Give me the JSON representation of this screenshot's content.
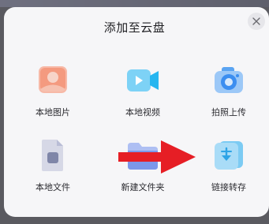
{
  "dialog": {
    "title": "添加至云盘",
    "close_icon": "close-icon"
  },
  "tiles": [
    {
      "label": "本地图片",
      "icon": "image-icon"
    },
    {
      "label": "本地视频",
      "icon": "video-icon"
    },
    {
      "label": "拍照上传",
      "icon": "camera-icon"
    },
    {
      "label": "本地文件",
      "icon": "file-icon"
    },
    {
      "label": "新建文件夹",
      "icon": "new-folder-icon"
    },
    {
      "label": "链接转存",
      "icon": "link-transfer-icon"
    }
  ],
  "colors": {
    "image_accent": "#f07a5f",
    "video_accent": "#27b6f0",
    "camera_accent": "#3c8ef0",
    "file_accent": "#7f86a8",
    "folder_accent": "#5b7fe0",
    "link_accent": "#2ea4e6",
    "overlay_arrow": "#e61e25"
  }
}
